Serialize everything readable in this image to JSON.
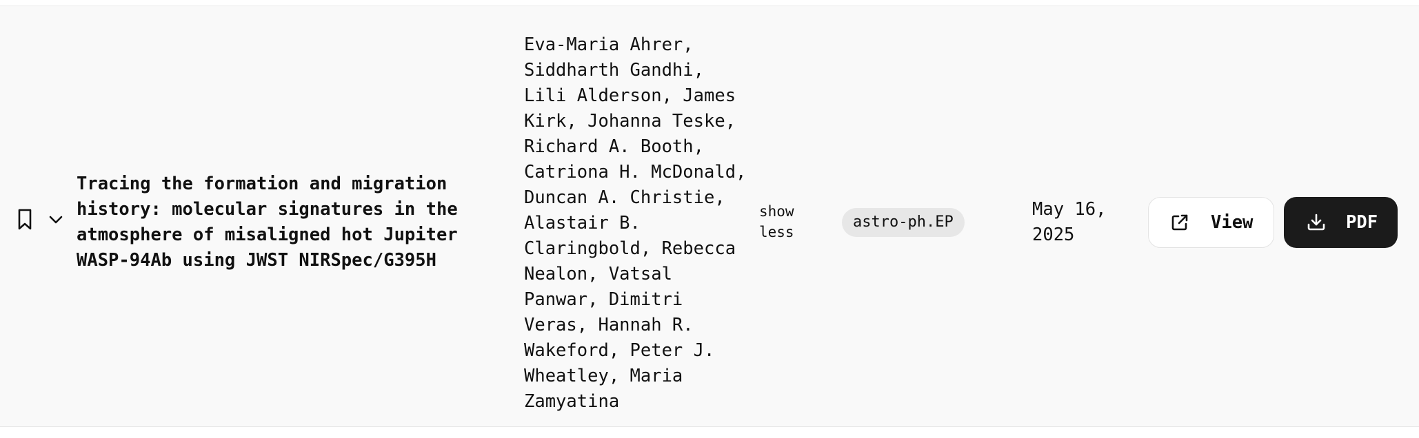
{
  "row": {
    "title": "Tracing the formation and migration\nhistory: molecular signatures in the\natmosphere of misaligned hot Jupiter\nWASP-94Ab using JWST NIRSpec/G395H",
    "authors": "Eva-Maria Ahrer,\nSiddharth Gandhi,\nLili Alderson, James\nKirk, Johanna Teske,\nRichard A. Booth,\nCatriona H. McDonald,\nDuncan A. Christie,\nAlastair B.\nClaringbold, Rebecca\nNealon, Vatsal\nPanwar, Dimitri\nVeras, Hannah R.\nWakeford, Peter J.\nWheatley, Maria\nZamyatina",
    "toggle_label": "show\nless",
    "category": "astro-ph.EP",
    "date": "May 16,\n2025",
    "view_label": "View",
    "pdf_label": "PDF"
  },
  "icons": {
    "bookmark": "bookmark-icon",
    "expand": "chevron-down-icon",
    "view": "external-link-icon",
    "pdf": "download-icon"
  },
  "colors": {
    "row_background": "#f9f9f9",
    "badge_background": "#e7e7e7",
    "pdf_button": "#1b1b1b"
  }
}
